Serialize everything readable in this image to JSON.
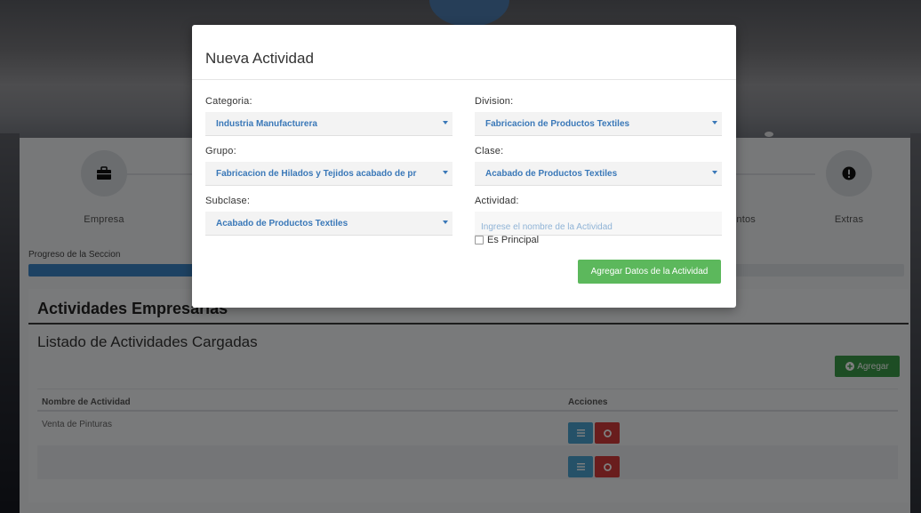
{
  "steps": [
    {
      "label": "Empresa",
      "icon": "briefcase-icon"
    },
    {
      "label": "ntos",
      "icon": ""
    },
    {
      "label": "Extras",
      "icon": "exclamation-icon"
    }
  ],
  "progress": {
    "label": "Progreso de la Seccion",
    "fraction": 0.21
  },
  "panel": {
    "title": "Actividades Empresarias",
    "subtitle": "Listado de Actividades Cargadas",
    "add_button": "Agregar",
    "table": {
      "headers": [
        "Nombre de Actividad",
        "Acciones"
      ],
      "rows": [
        {
          "name": "Venta de Pinturas"
        },
        {
          "name": ""
        }
      ]
    }
  },
  "modal": {
    "title": "Nueva Actividad",
    "categoria": {
      "label": "Categoria:",
      "value": "Industria Manufacturera"
    },
    "division": {
      "label": "Division:",
      "value": "Fabricacion de Productos Textiles"
    },
    "grupo": {
      "label": "Grupo:",
      "value": "Fabricacion de Hilados y Tejidos acabado de pr"
    },
    "clase": {
      "label": "Clase:",
      "value": "Acabado de Productos Textiles"
    },
    "subclase": {
      "label": "Subclase:",
      "value": "Acabado de Productos Textiles"
    },
    "actividad": {
      "label": "Actividad:",
      "placeholder": "Ingrese el nombre de la Actividad"
    },
    "principal_label": "Es Principal",
    "submit_label": "Agregar Datos de la Actividad"
  },
  "colors": {
    "primary": "#3b84c6",
    "success": "#5cb85c",
    "danger": "#d23a3a",
    "info": "#4aa3d0"
  }
}
